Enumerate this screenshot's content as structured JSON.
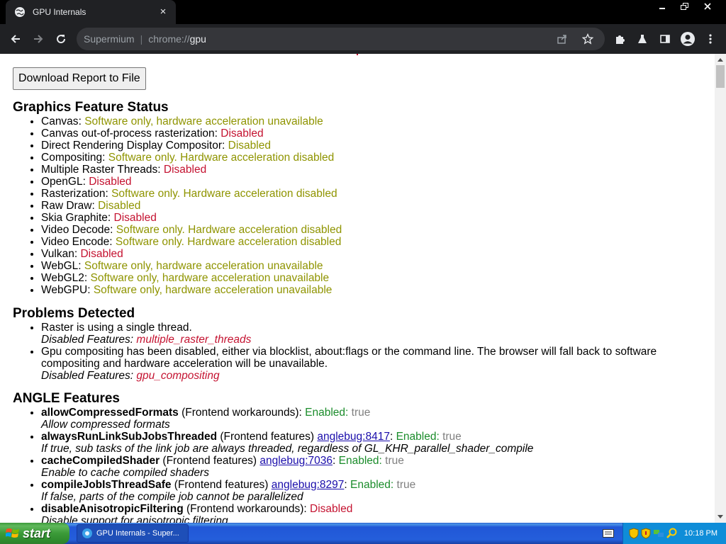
{
  "browser": {
    "tab_title": "GPU Internals",
    "tab_close": "×",
    "omnibox": {
      "prefix": "Supermium",
      "separator": "|",
      "scheme": "chrome://",
      "host": "gpu"
    }
  },
  "page": {
    "download_button": "Download Report to File",
    "graphics": {
      "heading": "Graphics Feature Status",
      "items": [
        {
          "name": "Canvas",
          "status": "Software only, hardware acceleration unavailable",
          "tone": "warn"
        },
        {
          "name": "Canvas out-of-process rasterization",
          "status": "Disabled",
          "tone": "bad"
        },
        {
          "name": "Direct Rendering Display Compositor",
          "status": "Disabled",
          "tone": "warn"
        },
        {
          "name": "Compositing",
          "status": "Software only. Hardware acceleration disabled",
          "tone": "warn"
        },
        {
          "name": "Multiple Raster Threads",
          "status": "Disabled",
          "tone": "bad"
        },
        {
          "name": "OpenGL",
          "status": "Disabled",
          "tone": "bad"
        },
        {
          "name": "Rasterization",
          "status": "Software only. Hardware acceleration disabled",
          "tone": "warn"
        },
        {
          "name": "Raw Draw",
          "status": "Disabled",
          "tone": "warn"
        },
        {
          "name": "Skia Graphite",
          "status": "Disabled",
          "tone": "bad"
        },
        {
          "name": "Video Decode",
          "status": "Software only. Hardware acceleration disabled",
          "tone": "warn"
        },
        {
          "name": "Video Encode",
          "status": "Software only. Hardware acceleration disabled",
          "tone": "warn"
        },
        {
          "name": "Vulkan",
          "status": "Disabled",
          "tone": "bad"
        },
        {
          "name": "WebGL",
          "status": "Software only, hardware acceleration unavailable",
          "tone": "warn"
        },
        {
          "name": "WebGL2",
          "status": "Software only, hardware acceleration unavailable",
          "tone": "warn"
        },
        {
          "name": "WebGPU",
          "status": "Software only, hardware acceleration unavailable",
          "tone": "warn"
        }
      ]
    },
    "problems": {
      "heading": "Problems Detected",
      "items": [
        {
          "text": "Raster is using a single thread.",
          "disabled_label": "Disabled Features:",
          "feature": "multiple_raster_threads"
        },
        {
          "text": "Gpu compositing has been disabled, either via blocklist, about:flags or the command line. The browser will fall back to software compositing and hardware acceleration will be unavailable.",
          "disabled_label": "Disabled Features:",
          "feature": "gpu_compositing"
        }
      ]
    },
    "angle": {
      "heading": "ANGLE Features",
      "items": [
        {
          "name": "allowCompressedFormats",
          "category": "(Frontend workarounds):",
          "bug": "",
          "state": "Enabled:",
          "value": "true",
          "tone": "good",
          "desc": "Allow compressed formats"
        },
        {
          "name": "alwaysRunLinkSubJobsThreaded",
          "category": "(Frontend features)",
          "bug": "anglebug:8417",
          "state": "Enabled:",
          "value": "true",
          "tone": "good",
          "desc": "If true, sub tasks of the link job are always threaded, regardless of GL_KHR_parallel_shader_compile"
        },
        {
          "name": "cacheCompiledShader",
          "category": "(Frontend features)",
          "bug": "anglebug:7036",
          "state": "Enabled:",
          "value": "true",
          "tone": "good",
          "desc": "Enable to cache compiled shaders"
        },
        {
          "name": "compileJobIsThreadSafe",
          "category": "(Frontend features)",
          "bug": "anglebug:8297",
          "state": "Enabled:",
          "value": "true",
          "tone": "good",
          "desc": "If false, parts of the compile job cannot be parallelized"
        },
        {
          "name": "disableAnisotropicFiltering",
          "category": "(Frontend workarounds):",
          "bug": "",
          "state": "Disabled",
          "value": "",
          "tone": "bad",
          "desc": "Disable support for anisotropic filtering"
        }
      ]
    }
  },
  "taskbar": {
    "start_label": "start",
    "task_label": "GPU Internals - Super...",
    "clock": "10:18 PM"
  },
  "colors": {
    "warn": "#8f9400",
    "bad": "#c41230",
    "good": "#1a8c2a",
    "chrome_dark": "#202124"
  }
}
